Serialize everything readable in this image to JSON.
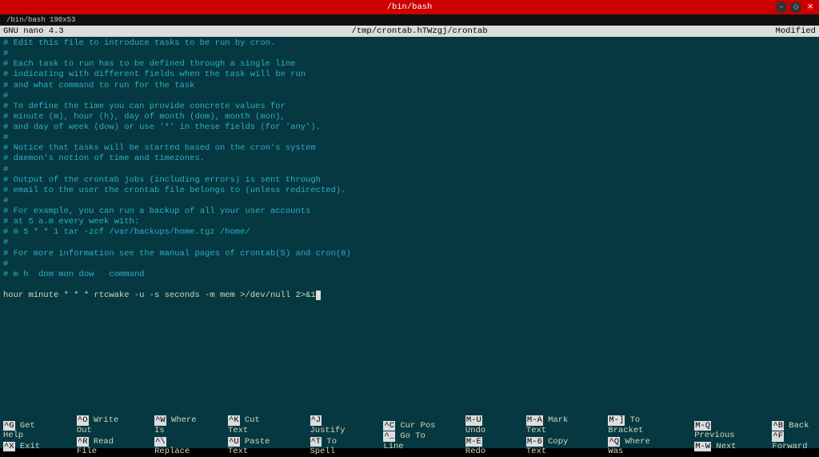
{
  "window": {
    "title": "/bin/bash",
    "tab": "/bin/bash 190x53"
  },
  "nano": {
    "version": "GNU nano 4.3",
    "filepath": "/tmp/crontab.hTWzgj/crontab",
    "status": "Modified"
  },
  "editor_lines": [
    "# Edit this file to introduce tasks to be run by cron.",
    "#",
    "# Each task to run has to be defined through a single line",
    "# indicating with different fields when the task will be run",
    "# and what command to run for the task",
    "#",
    "# To define the time you can provide concrete values for",
    "# minute (m), hour (h), day of month (dom), month (mon),",
    "# and day of week (dow) or use '*' in these fields (for 'any').",
    "#",
    "# Notice that tasks will be started based on the cron's system",
    "# daemon's notion of time and timezones.",
    "#",
    "# Output of the crontab jobs (including errors) is sent through",
    "# email to the user the crontab file belongs to (unless redirected).",
    "#",
    "# For example, you can run a backup of all your user accounts",
    "# at 5 a.m every week with:",
    "# 0 5 * * 1 tar -zcf /var/backups/home.tgz /home/",
    "#",
    "# For more information see the manual pages of crontab(5) and cron(8)",
    "#",
    "# m h  dom mon dow   command",
    ""
  ],
  "command": "hour minute * * * rtcwake -u -s seconds -m mem >/dev/null 2>&1",
  "shortcuts": [
    [
      [
        "^G",
        "Get Help"
      ],
      [
        "^X",
        "Exit"
      ]
    ],
    [
      [
        "^O",
        "Write Out"
      ],
      [
        "^R",
        "Read File"
      ]
    ],
    [
      [
        "^W",
        "Where Is"
      ],
      [
        "^\\",
        "Replace"
      ]
    ],
    [
      [
        "^K",
        "Cut Text"
      ],
      [
        "^U",
        "Paste Text"
      ]
    ],
    [
      [
        "^J",
        "Justify"
      ],
      [
        "^T",
        "To Spell"
      ]
    ],
    [
      [
        "^C",
        "Cur Pos"
      ],
      [
        "^_",
        "Go To Line"
      ]
    ],
    [
      [
        "M-U",
        "Undo"
      ],
      [
        "M-E",
        "Redo"
      ]
    ],
    [
      [
        "M-A",
        "Mark Text"
      ],
      [
        "M-6",
        "Copy Text"
      ]
    ],
    [
      [
        "M-]",
        "To Bracket"
      ],
      [
        "^Q",
        "Where Was"
      ]
    ],
    [
      [
        "M-Q",
        "Previous"
      ],
      [
        "M-W",
        "Next"
      ]
    ],
    [
      [
        "^B",
        "Back"
      ],
      [
        "^F",
        "Forward"
      ]
    ]
  ]
}
